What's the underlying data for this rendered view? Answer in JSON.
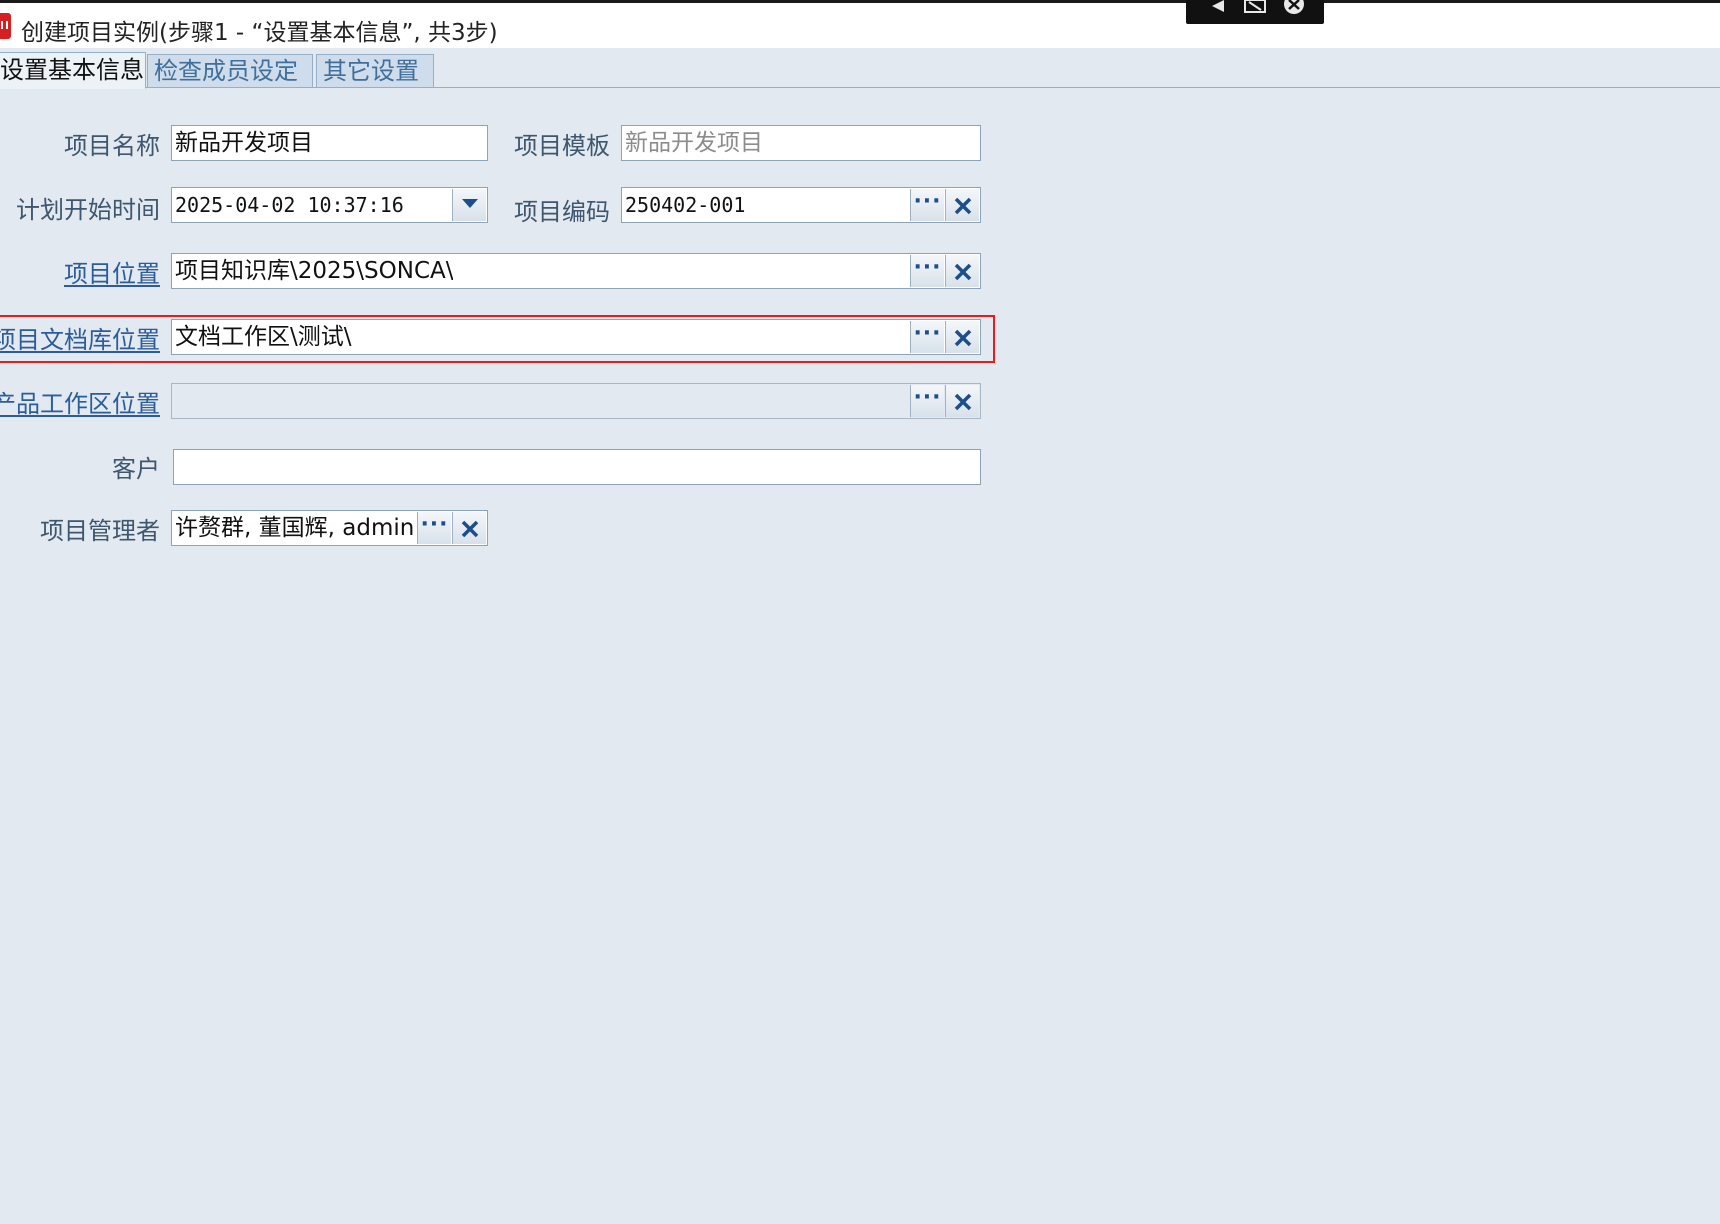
{
  "window": {
    "title": "创建项目实例(步骤1 - “设置基本信息”, 共3步)"
  },
  "overlay": {
    "icons": [
      "back-icon",
      "fit-icon",
      "close-circle-icon"
    ]
  },
  "tabs": [
    {
      "label": "设置基本信息",
      "active": true
    },
    {
      "label": "检查成员设定",
      "active": false
    },
    {
      "label": "其它设置",
      "active": false
    }
  ],
  "form": {
    "project_name": {
      "label": "项目名称",
      "value": "新品开发项目"
    },
    "project_template": {
      "label": "项目模板",
      "value": "新品开发项目"
    },
    "planned_start": {
      "label": "计划开始时间",
      "value": "2025-04-02 10:37:16"
    },
    "project_code": {
      "label": "项目编码",
      "value": "250402-001"
    },
    "project_location": {
      "label": "项目位置",
      "value": "项目知识库\\2025\\SONCA\\"
    },
    "doc_library_location": {
      "label": "项目文档库位置",
      "value": "文档工作区\\测试\\"
    },
    "product_workspace_location": {
      "label": "产品工作区位置",
      "value": ""
    },
    "customer": {
      "label": "客户",
      "value": ""
    },
    "project_managers": {
      "label": "项目管理者",
      "value": "许赘群, 董国辉, admin"
    }
  },
  "buttons": {
    "browse_label": "···"
  },
  "colors": {
    "background": "#e3e9f0",
    "label_text": "#3e566e",
    "link_text": "#2a5d9a",
    "highlight": "#e02020",
    "app_icon": "#d42020"
  }
}
